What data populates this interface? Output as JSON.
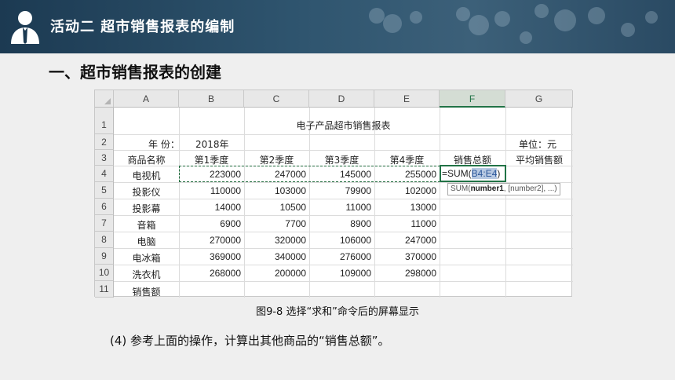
{
  "banner": {
    "title": "活动二  超市销售报表的编制",
    "icon": "businessman-icon"
  },
  "heading": "一、超市销售报表的创建",
  "sheet": {
    "columns": [
      "A",
      "B",
      "C",
      "D",
      "E",
      "F",
      "G"
    ],
    "selected_column": "F",
    "rows": [
      "1",
      "2",
      "3",
      "4",
      "5",
      "6",
      "7",
      "8",
      "9",
      "10",
      "11"
    ],
    "title": "电子产品超市销售报表",
    "year_label": "年 份：",
    "year_value": "2018年",
    "unit_label": "单位：元",
    "headers": [
      "商品名称",
      "第1季度",
      "第2季度",
      "第3季度",
      "第4季度",
      "销售总额",
      "平均销售额"
    ],
    "products": [
      {
        "name": "电视机",
        "q1": "223000",
        "q2": "247000",
        "q3": "145000",
        "q4": "255000"
      },
      {
        "name": "投影仪",
        "q1": "110000",
        "q2": "103000",
        "q3": "79900",
        "q4": "102000"
      },
      {
        "name": "投影幕",
        "q1": "14000",
        "q2": "10500",
        "q3": "11000",
        "q4": "13000"
      },
      {
        "name": "音箱",
        "q1": "6900",
        "q2": "7700",
        "q3": "8900",
        "q4": "11000"
      },
      {
        "name": "电脑",
        "q1": "270000",
        "q2": "320000",
        "q3": "106000",
        "q4": "247000"
      },
      {
        "name": "电冰箱",
        "q1": "369000",
        "q2": "340000",
        "q3": "276000",
        "q4": "370000"
      },
      {
        "name": "洗衣机",
        "q1": "268000",
        "q2": "200000",
        "q3": "109000",
        "q4": "298000"
      }
    ],
    "total_label": "销售额",
    "formula_prefix": "=SUM(",
    "formula_ref": "B4:E4",
    "formula_suffix": ")",
    "tooltip_prefix": "SUM(",
    "tooltip_arg1": "number1",
    "tooltip_rest": ", [number2], ...)",
    "accent_color": "#217346"
  },
  "caption": "图9-8  选择“求和”命令后的屏幕显示",
  "note": "(4) 参考上面的操作，计算出其他商品的“销售总额”。"
}
